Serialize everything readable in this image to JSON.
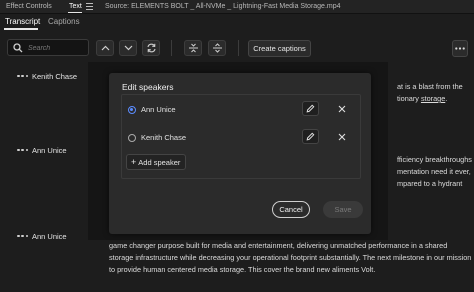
{
  "panel_tabs": {
    "effect_controls": "Effect Controls",
    "text": "Text",
    "source": "Source: ELEMENTS BOLT _ All-NVMe _ Lightning-Fast Media Storage.mp4"
  },
  "sub_tabs": {
    "transcript": "Transcript",
    "captions": "Captions"
  },
  "toolbar": {
    "search_placeholder": "Search",
    "create_captions": "Create captions"
  },
  "transcript": {
    "speakers": [
      {
        "name": "Kenith Chase"
      },
      {
        "name": "Ann Unice"
      },
      {
        "name": "Ann Unice"
      }
    ],
    "right_lines_1": [
      "at is a blast from the",
      "tionary ",
      "storage",
      "."
    ],
    "right_lines_2": [
      "fficiency breakthroughs",
      "mentation need it ever,",
      "mpared to a hydrant"
    ],
    "bottom_lines": [
      "game changer purpose built for media and entertainment, delivering unmatched performance in a shared",
      "storage infrastructure while decreasing your operational footprint substantially. The next milestone in our mission",
      "to provide human centered media storage. This cover the brand new aliments Volt."
    ]
  },
  "dialog": {
    "title": "Edit speakers",
    "speakers": [
      {
        "label": "Ann Unice",
        "selected": true
      },
      {
        "label": "Kenith Chase",
        "selected": false
      }
    ],
    "add_speaker": "Add speaker",
    "cancel": "Cancel",
    "save": "Save"
  },
  "colors": {
    "accent_radio": "#5b8cff",
    "background": "#1d1d1d",
    "dialog": "#2b2b2b"
  }
}
